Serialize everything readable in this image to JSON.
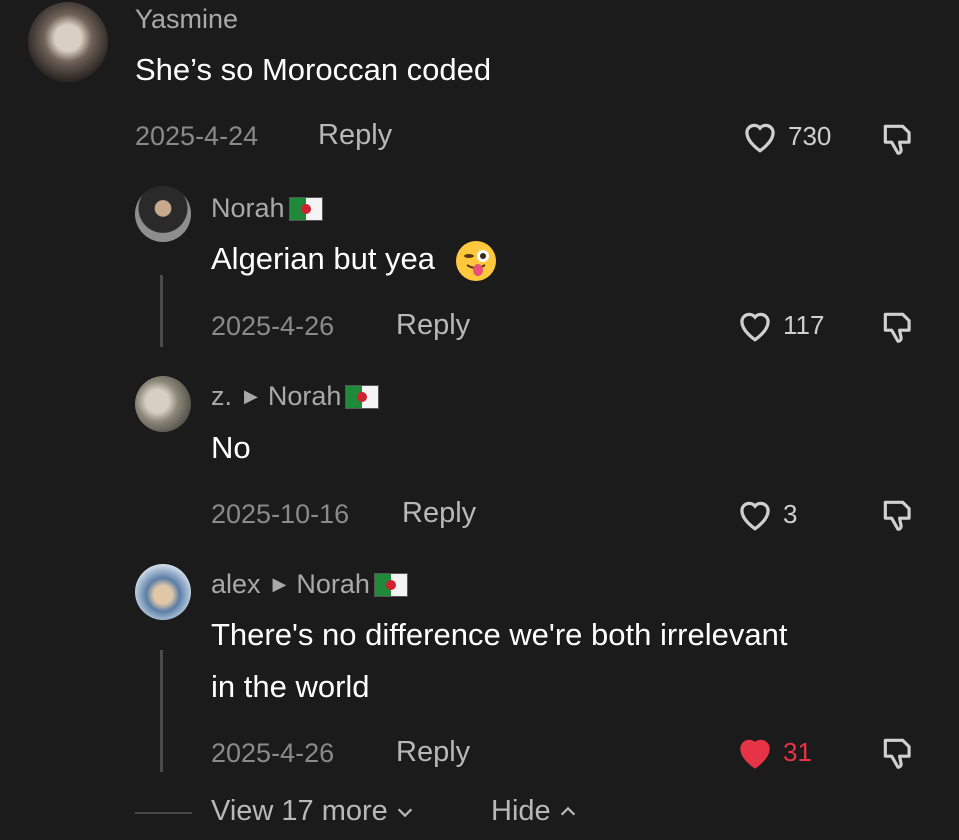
{
  "comments": [
    {
      "author": "Yasmine",
      "text": "She’s so Moroccan coded",
      "date": "2025-4-24",
      "reply_label": "Reply",
      "likes": "730"
    },
    {
      "author": "Norah",
      "text": "Algerian but yea",
      "date": "2025-4-26",
      "reply_label": "Reply",
      "likes": "117"
    },
    {
      "author": "z.",
      "reply_to": "Norah",
      "text": "No",
      "date": "2025-10-16",
      "reply_label": "Reply",
      "likes": "3"
    },
    {
      "author": "alex",
      "reply_to": "Norah",
      "text_line1": "There's no difference we're both irrelevant",
      "text_line2": "in the world",
      "date": "2025-4-26",
      "reply_label": "Reply",
      "likes": "31",
      "liked": true
    }
  ],
  "footer": {
    "view_more": "View 17 more",
    "hide": "Hide"
  },
  "colors": {
    "background": "#1b1b1b",
    "liked_heart": "#e63446",
    "muted_text": "#a9a9a9"
  }
}
